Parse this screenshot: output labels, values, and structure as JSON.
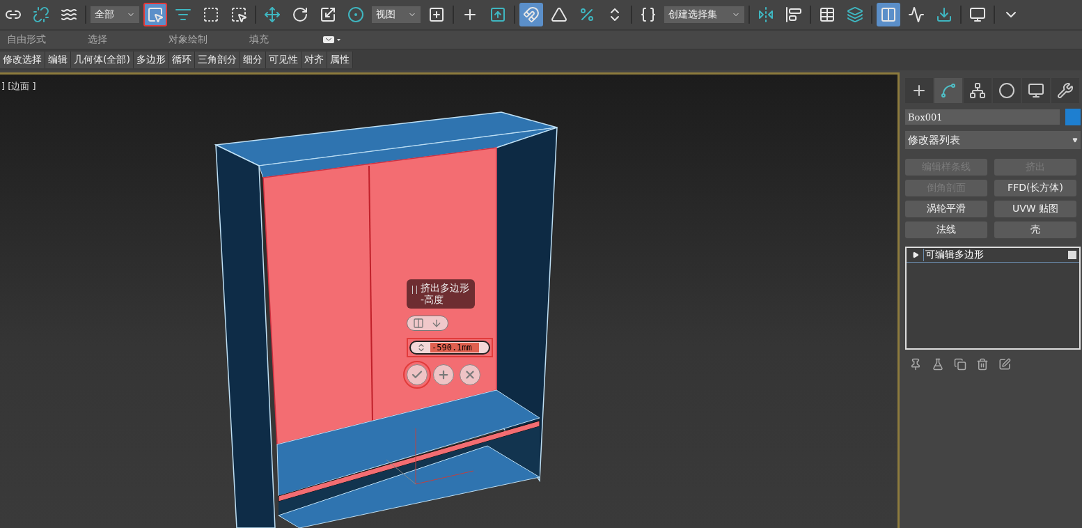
{
  "toolbar": [
    {
      "kind": "icon",
      "on": false,
      "highlighted": false
    },
    {
      "kind": "icon",
      "on": false,
      "highlighted": false
    },
    {
      "kind": "icon",
      "on": false,
      "highlighted": false
    },
    {
      "kind": "separator"
    },
    {
      "kind": "dropdown",
      "value": "全部"
    },
    {
      "kind": "icon",
      "on": true,
      "highlighted": true
    },
    {
      "kind": "icon",
      "on": false,
      "highlighted": false
    },
    {
      "kind": "icon",
      "on": false,
      "highlighted": false
    },
    {
      "kind": "icon",
      "on": false,
      "highlighted": false
    },
    {
      "kind": "separator"
    },
    {
      "kind": "icon",
      "on": false,
      "highlighted": false
    },
    {
      "kind": "icon",
      "on": false,
      "highlighted": false
    },
    {
      "kind": "icon",
      "on": false,
      "highlighted": false
    },
    {
      "kind": "icon",
      "on": false,
      "highlighted": false
    },
    {
      "kind": "dropdown",
      "value": "视图"
    },
    {
      "kind": "icon",
      "on": false,
      "highlighted": false
    },
    {
      "kind": "separator"
    },
    {
      "kind": "icon",
      "on": false,
      "highlighted": false
    },
    {
      "kind": "icon",
      "on": false,
      "highlighted": false
    },
    {
      "kind": "separator"
    },
    {
      "kind": "icon",
      "on": true,
      "highlighted": false
    },
    {
      "kind": "icon",
      "on": false,
      "highlighted": false
    },
    {
      "kind": "icon",
      "on": false,
      "highlighted": false
    },
    {
      "kind": "icon",
      "on": false,
      "highlighted": false
    },
    {
      "kind": "separator"
    },
    {
      "kind": "icon",
      "on": false,
      "highlighted": false
    },
    {
      "kind": "dropdown",
      "value": "创建选择集"
    },
    {
      "kind": "separator"
    },
    {
      "kind": "icon",
      "on": false,
      "highlighted": false
    },
    {
      "kind": "icon",
      "on": false,
      "highlighted": false
    },
    {
      "kind": "separator"
    },
    {
      "kind": "icon",
      "on": false,
      "highlighted": false
    },
    {
      "kind": "icon",
      "on": false,
      "highlighted": false
    },
    {
      "kind": "separator"
    },
    {
      "kind": "icon",
      "on": true,
      "highlighted": false
    },
    {
      "kind": "icon",
      "on": false,
      "highlighted": false
    },
    {
      "kind": "icon",
      "on": false,
      "highlighted": false
    },
    {
      "kind": "separator"
    },
    {
      "kind": "icon",
      "on": false,
      "highlighted": false
    },
    {
      "kind": "separator"
    },
    {
      "kind": "icon",
      "on": false,
      "highlighted": false
    }
  ],
  "ribbon_tabs": [
    "自由形式",
    "选择",
    "对象绘制",
    "填充"
  ],
  "ribbon_panel": [
    "修改选择",
    "编辑",
    "几何体(全部)",
    "多边形",
    "循环",
    "三角剖分",
    "细分",
    "可见性",
    "对齐",
    "属性"
  ],
  "viewport": {
    "label": "] [边面 ]"
  },
  "caddy": {
    "title": "挤出多边形\n-高度",
    "value": "-590.1mm",
    "value_highlighted": true,
    "buttons": [
      {
        "kind": "ok",
        "highlighted": true
      },
      {
        "kind": "apply",
        "highlighted": false
      },
      {
        "kind": "cancel",
        "highlighted": false
      }
    ]
  },
  "command_panel": {
    "tabs": [
      {
        "selected": false
      },
      {
        "selected": true
      },
      {
        "selected": false
      },
      {
        "selected": false
      },
      {
        "selected": false
      },
      {
        "selected": false
      }
    ],
    "object_name": "Box001",
    "modifier_list": "修改器列表",
    "modifier_buttons": [
      {
        "label": "编辑样条线",
        "disabled": true
      },
      {
        "label": "挤出",
        "disabled": true
      },
      {
        "label": "倒角剖面",
        "disabled": true
      },
      {
        "label": "FFD(长方体)",
        "disabled": false
      },
      {
        "label": "涡轮平滑",
        "disabled": false
      },
      {
        "label": "UVW 贴图",
        "disabled": false
      },
      {
        "label": "法线",
        "disabled": false
      },
      {
        "label": "壳",
        "disabled": false
      }
    ],
    "stack": [
      {
        "label": "可编辑多边形",
        "selected": true
      }
    ]
  }
}
